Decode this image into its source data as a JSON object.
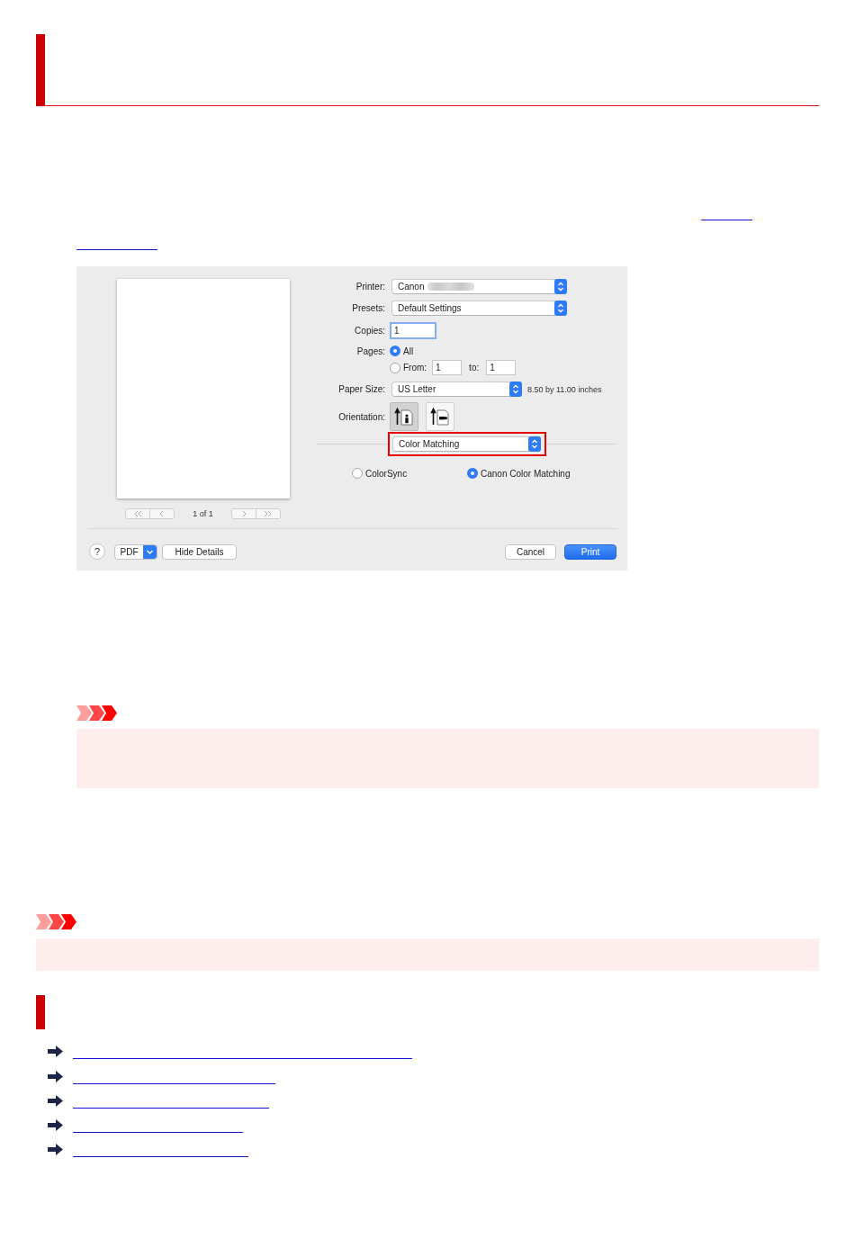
{
  "print_dialog": {
    "preview": {
      "page_counter": "1 of 1"
    },
    "printer": {
      "label": "Printer:",
      "value": "Canon",
      "redacted": true
    },
    "presets": {
      "label": "Presets:",
      "value": "Default Settings"
    },
    "copies": {
      "label": "Copies:",
      "value": "1",
      "focused": true
    },
    "pages": {
      "label": "Pages:",
      "options": [
        {
          "label": "All",
          "selected": true
        },
        {
          "label": "From:",
          "selected": false
        }
      ],
      "from": "1",
      "to_label": "to:",
      "to": "1"
    },
    "paper_size": {
      "label": "Paper Size:",
      "value": "US Letter",
      "dimensions": "8.50 by 11.00 inches"
    },
    "orientation": {
      "label": "Orientation:",
      "options": [
        {
          "kind": "portrait",
          "selected": true
        },
        {
          "kind": "landscape",
          "selected": false
        }
      ]
    },
    "panel_menu": {
      "value": "Color Matching",
      "highlighted": true
    },
    "matching": [
      {
        "label": "ColorSync",
        "selected": false
      },
      {
        "label": "Canon Color Matching",
        "selected": true
      }
    ],
    "footer": {
      "help": "?",
      "pdf": "PDF",
      "details_button": "Hide Details",
      "buttons": [
        {
          "label": "Cancel",
          "kind": "normal"
        },
        {
          "label": "Print",
          "kind": "default"
        }
      ]
    }
  }
}
